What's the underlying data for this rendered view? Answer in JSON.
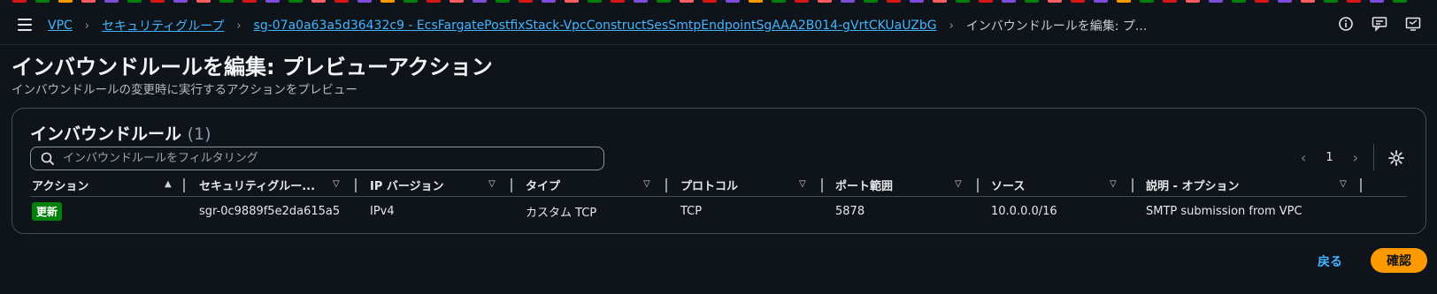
{
  "top_strip_colors": [
    "#d91515",
    "#037f0c",
    "#ff9900",
    "#ff5d64",
    "#7d4cdb",
    "#037f0c",
    "#d91515",
    "#7d4cdb",
    "#ff5d64",
    "#037f0c",
    "#d91515",
    "#7d4cdb",
    "#037f0c",
    "#ff5d64",
    "#d91515",
    "#7d4cdb",
    "#ff9900",
    "#037f0c",
    "#d91515",
    "#ff5d64",
    "#7d4cdb",
    "#037f0c",
    "#d91515",
    "#7d4cdb",
    "#ff5d64",
    "#037f0c",
    "#d91515",
    "#7d4cdb",
    "#037f0c",
    "#ff5d64",
    "#d91515",
    "#7d4cdb",
    "#ff9900",
    "#037f0c",
    "#d91515",
    "#ff5d64",
    "#7d4cdb",
    "#037f0c",
    "#d91515",
    "#7d4cdb",
    "#ff5d64",
    "#037f0c",
    "#d91515",
    "#7d4cdb",
    "#037f0c",
    "#ff5d64",
    "#d91515",
    "#7d4cdb",
    "#ff9900",
    "#037f0c",
    "#d91515",
    "#ff5d64",
    "#7d4cdb",
    "#037f0c",
    "#d91515",
    "#7d4cdb",
    "#ff5d64",
    "#037f0c",
    "#d91515",
    "#7d4cdb",
    "#037f0c"
  ],
  "breadcrumb": {
    "vpc": "VPC",
    "security_groups": "セキュリティグループ",
    "sg": "sg-07a0a63a5d36432c9 - EcsFargatePostfixStack-VpcConstructSesSmtpEndpointSgAAA2B014-gVrtCKUaUZbG",
    "current": "インバウンドルールを編集: プ..."
  },
  "icons": {
    "menu": "hamburger-icon",
    "info": "info-icon",
    "feedback": "feedback-icon",
    "notifications": "screen-notification-icon"
  },
  "header": {
    "title": "インバウンドルールを編集: プレビューアクション",
    "description": "インバウンドルールの変更時に実行するアクションをプレビュー"
  },
  "panel": {
    "title": "インバウンドルール",
    "count": "(1)",
    "filter_placeholder": "インバウンドルールをフィルタリング",
    "page": "1",
    "prev": "‹",
    "next": "›"
  },
  "table": {
    "columns": [
      "アクション",
      "セキュリティグルー...",
      "IP バージョン",
      "タイプ",
      "プロトコル",
      "ポート範囲",
      "ソース",
      "説明 - オプション"
    ],
    "rows": [
      [
        "更新",
        "sgr-0c9889f5e2da615a5",
        "IPv4",
        "カスタム TCP",
        "TCP",
        "5878",
        "10.0.0.0/16",
        "SMTP submission from VPC"
      ]
    ]
  },
  "footer": {
    "back": "戻る",
    "confirm": "確認"
  },
  "colors": {
    "accent": "#ff9900",
    "link": "#42b4ff",
    "badge": "#037f0c",
    "background": "#0f141a"
  }
}
